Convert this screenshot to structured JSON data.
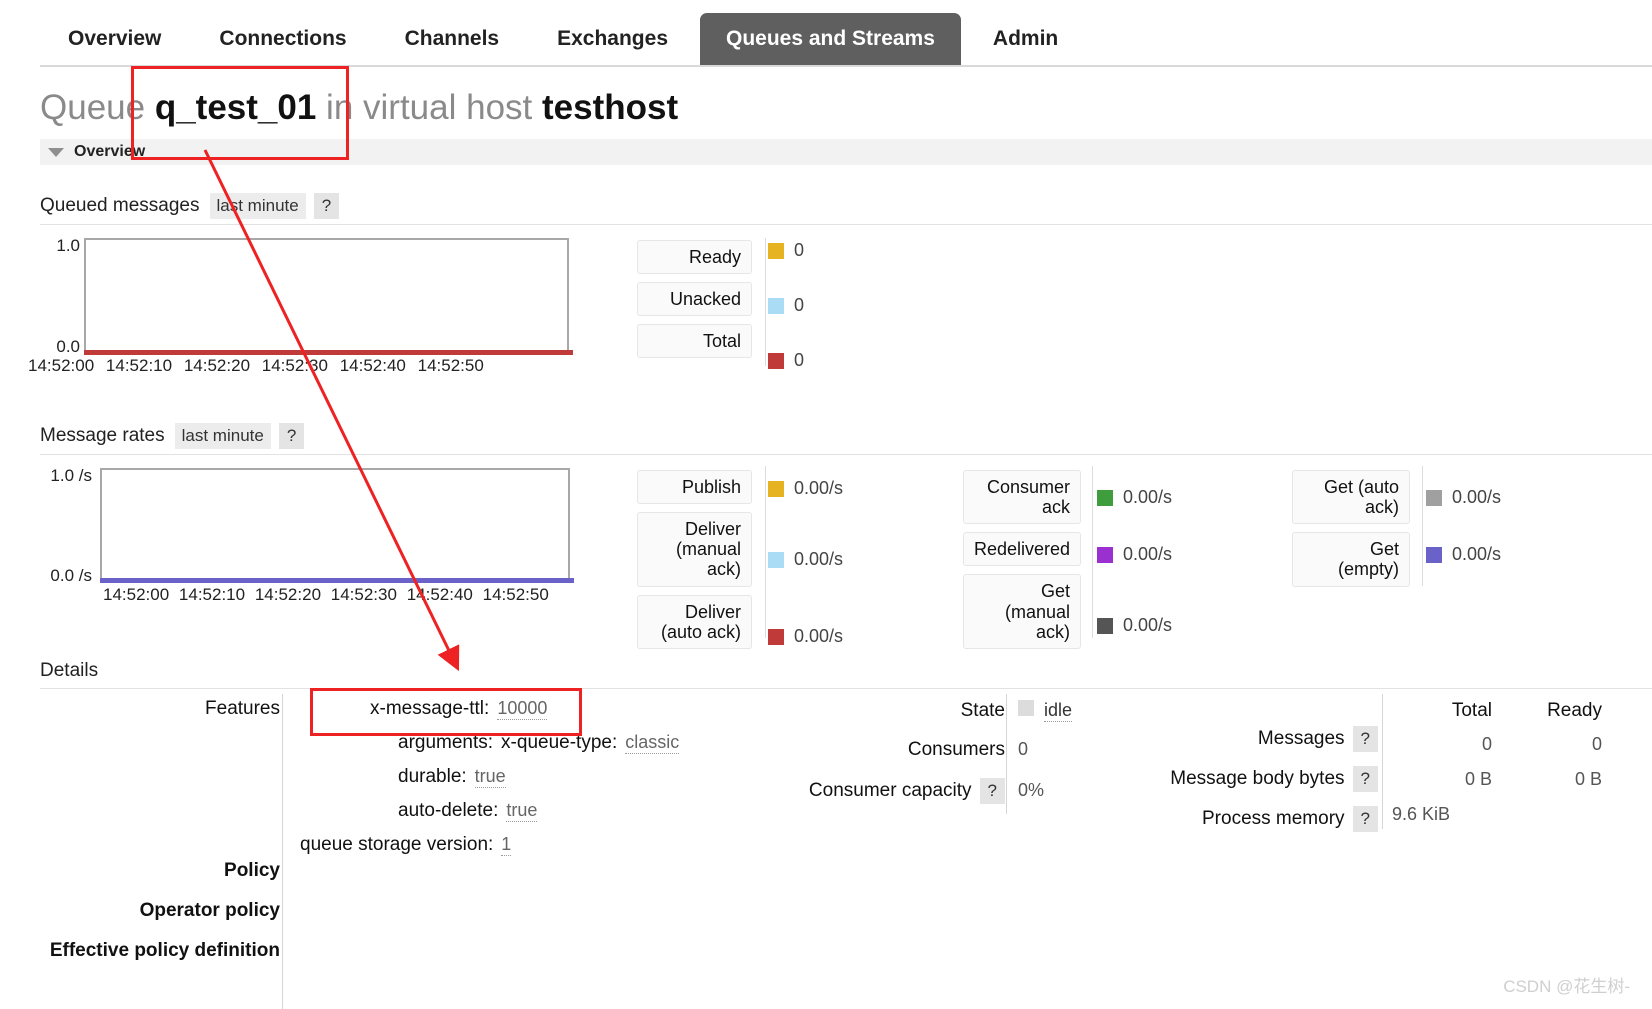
{
  "nav": {
    "items": [
      {
        "label": "Overview",
        "active": false
      },
      {
        "label": "Connections",
        "active": false
      },
      {
        "label": "Channels",
        "active": false
      },
      {
        "label": "Exchanges",
        "active": false
      },
      {
        "label": "Queues and Streams",
        "active": true
      },
      {
        "label": "Admin",
        "active": false
      }
    ]
  },
  "page": {
    "title_prefix": "Queue",
    "queue_name": "q_test_01",
    "title_middle": "in virtual host",
    "vhost": "testhost",
    "overview_section_label": "Overview",
    "details_label": "Details"
  },
  "queued_messages": {
    "title": "Queued messages",
    "range_pill": "last minute",
    "help": "?",
    "y_top": "1.0",
    "y_bottom": "0.0",
    "x_ticks": [
      "14:52:00",
      "14:52:10",
      "14:52:20",
      "14:52:30",
      "14:52:40",
      "14:52:50"
    ],
    "legend": [
      {
        "label": "Ready",
        "value": "0",
        "color": "#e6b422"
      },
      {
        "label": "Unacked",
        "value": "0",
        "color": "#aadcf5"
      },
      {
        "label": "Total",
        "value": "0",
        "color": "#c13a3a"
      }
    ]
  },
  "message_rates": {
    "title": "Message rates",
    "range_pill": "last minute",
    "help": "?",
    "y_top": "1.0 /s",
    "y_bottom": "0.0 /s",
    "x_ticks": [
      "14:52:00",
      "14:52:10",
      "14:52:20",
      "14:52:30",
      "14:52:40",
      "14:52:50"
    ],
    "col1": [
      {
        "label": "Publish",
        "value": "0.00/s",
        "color": "#e6b422"
      },
      {
        "label": "Deliver\n(manual\nack)",
        "value": "0.00/s",
        "color": "#aadcf5"
      },
      {
        "label": "Deliver\n(auto ack)",
        "value": "0.00/s",
        "color": "#c13a3a"
      }
    ],
    "col2": [
      {
        "label": "Consumer\nack",
        "value": "0.00/s",
        "color": "#3e9e3e"
      },
      {
        "label": "Redelivered",
        "value": "0.00/s",
        "color": "#9b30d0"
      },
      {
        "label": "Get\n(manual\nack)",
        "value": "0.00/s",
        "color": "#555555"
      }
    ],
    "col3": [
      {
        "label": "Get (auto\nack)",
        "value": "0.00/s",
        "color": "#a0a0a0"
      },
      {
        "label": "Get\n(empty)",
        "value": "0.00/s",
        "color": "#6a62c8"
      }
    ]
  },
  "details": {
    "features_label": "Features",
    "features": [
      {
        "key": "x-message-ttl:",
        "value": "10000"
      },
      {
        "key": "arguments:",
        "value": "x-queue-type:",
        "value2": "classic"
      },
      {
        "key": "durable:",
        "value": "true"
      },
      {
        "key": "auto-delete:",
        "value": "true"
      },
      {
        "key": "queue storage version:",
        "value": "1"
      }
    ],
    "policy_label": "Policy",
    "operator_policy_label": "Operator policy",
    "effective_policy_label": "Effective policy definition",
    "state_label": "State",
    "state_value": "idle",
    "consumers_label": "Consumers",
    "consumers_value": "0",
    "consumer_capacity_label": "Consumer capacity",
    "consumer_capacity_help": "?",
    "consumer_capacity_value": "0%",
    "stats_col_total": "Total",
    "stats_col_ready": "Ready",
    "stats_rows": [
      {
        "label": "Messages",
        "help": "?",
        "total": "0",
        "ready": "0"
      },
      {
        "label": "Message body bytes",
        "help": "?",
        "total": "0 B",
        "ready": "0 B"
      },
      {
        "label": "Process memory",
        "help": "?",
        "total": "9.6 KiB",
        "ready": ""
      }
    ]
  },
  "watermark": {
    "text": "CSDN @花生树-"
  },
  "annotations": {
    "accent": "#ee2222"
  }
}
